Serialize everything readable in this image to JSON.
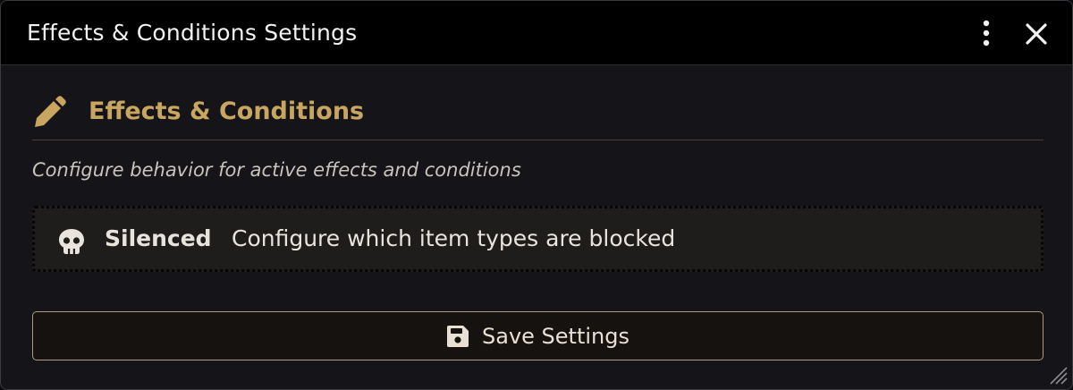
{
  "window": {
    "title": "Effects & Conditions Settings"
  },
  "section": {
    "icon": "pencil-icon",
    "title": "Effects & Conditions",
    "description": "Configure behavior for active effects and conditions"
  },
  "effects": [
    {
      "icon": "skull-icon",
      "name": "Silenced",
      "description": "Configure which item types are blocked"
    }
  ],
  "actions": {
    "save_icon": "floppy-disk-icon",
    "save_label": "Save Settings"
  },
  "colors": {
    "accent": "#c9a660",
    "titlebar_bg": "#000000",
    "panel_bg": "#141419",
    "row_bg": "#1f1d1b",
    "button_border": "#b09a82"
  }
}
